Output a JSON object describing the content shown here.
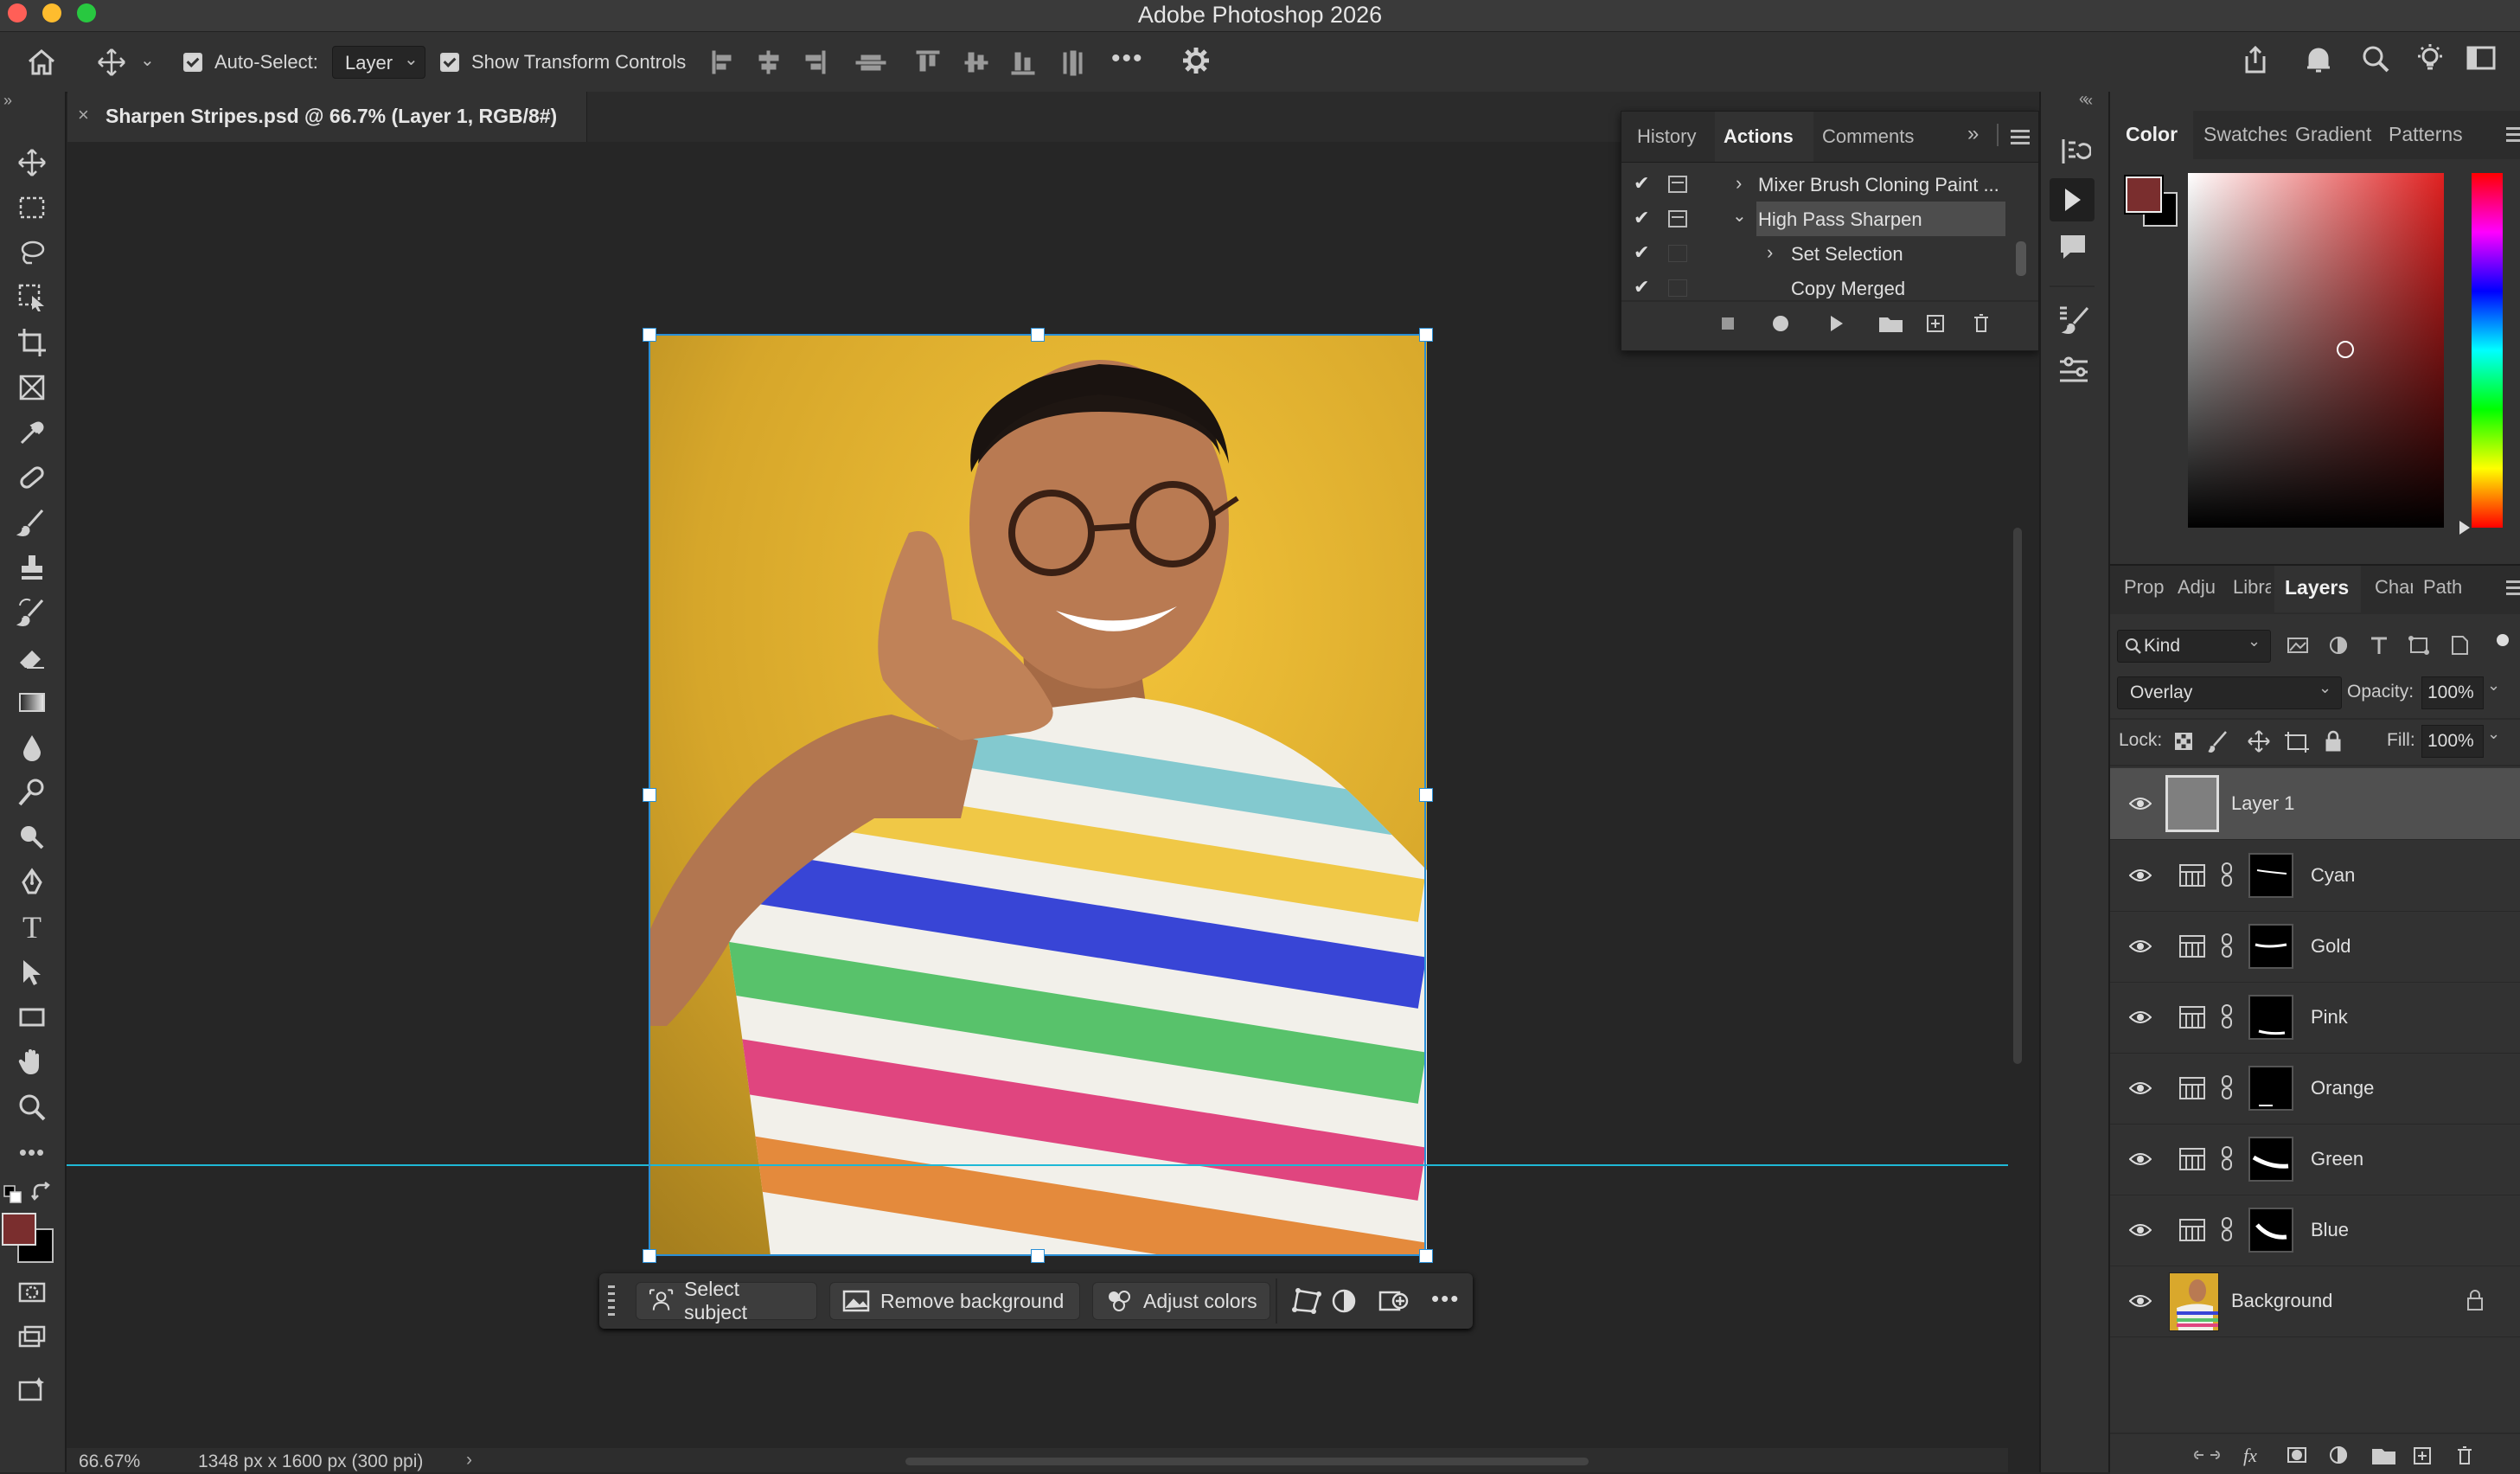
{
  "window": {
    "title": "Adobe Photoshop 2026"
  },
  "options_bar": {
    "auto_select_label": "Auto-Select:",
    "auto_select_value": "Layer",
    "show_transform_label": "Show Transform Controls",
    "more": "•••"
  },
  "document": {
    "tab_title": "Sharpen Stripes.psd @ 66.7% (Layer 1, RGB/8#)"
  },
  "status": {
    "zoom": "66.67%",
    "info": "1348 px x 1600 px (300 ppi)"
  },
  "actions_panel": {
    "tabs": [
      "History",
      "Actions",
      "Comments"
    ],
    "active_tab": "Actions",
    "rows": [
      "Mixer Brush Cloning Paint ...",
      "High Pass Sharpen",
      "Set Selection",
      "Copy Merged"
    ]
  },
  "color_panel": {
    "tabs": [
      "Color",
      "Swatches",
      "Gradient",
      "Patterns"
    ],
    "foreground": "#7a2e2e",
    "background": "#000000",
    "hue": "#e02020"
  },
  "layers_panel": {
    "tabs": [
      "Prop",
      "Adju",
      "Libra",
      "Layers",
      "Char",
      "Path"
    ],
    "filter": "Kind",
    "blend_mode": "Overlay",
    "opacity_label": "Opacity:",
    "opacity": "100%",
    "lock_label": "Lock:",
    "fill_label": "Fill:",
    "fill": "100%",
    "layers": [
      {
        "name": "Layer 1"
      },
      {
        "name": "Cyan"
      },
      {
        "name": "Gold"
      },
      {
        "name": "Pink"
      },
      {
        "name": "Orange"
      },
      {
        "name": "Green"
      },
      {
        "name": "Blue"
      },
      {
        "name": "Background"
      }
    ]
  },
  "context_bar": {
    "select_subject": "Select subject",
    "remove_background": "Remove background",
    "adjust_colors": "Adjust colors",
    "more": "•••"
  }
}
